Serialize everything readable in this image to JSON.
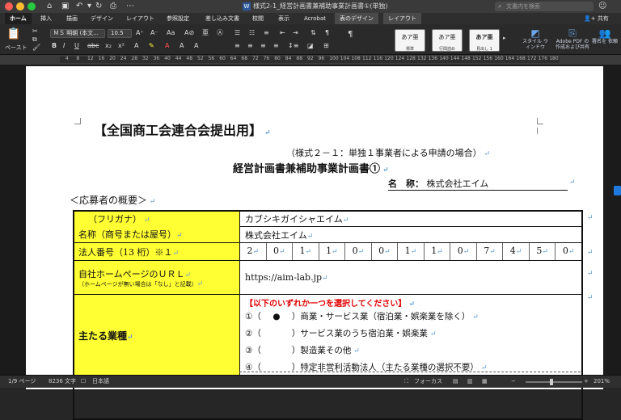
{
  "titlebar": {
    "document_title": "様式2-1_経営計画書兼補助事業計画書①(単独)",
    "search_placeholder": "文書内を検索"
  },
  "tabs": [
    {
      "label": "ホーム"
    },
    {
      "label": "挿入"
    },
    {
      "label": "描画"
    },
    {
      "label": "デザイン"
    },
    {
      "label": "レイアウト"
    },
    {
      "label": "参照設定"
    },
    {
      "label": "差し込み文書"
    },
    {
      "label": "校閲"
    },
    {
      "label": "表示"
    },
    {
      "label": "Acrobat"
    },
    {
      "label": "表のデザイン"
    },
    {
      "label": "レイアウト"
    }
  ],
  "share_label": "共有",
  "ribbon": {
    "paste_label": "ペースト",
    "font_name": "ＭＳ 明朝 (本文...",
    "font_size": "10.5",
    "styles": [
      {
        "sample": "あア亜",
        "name": "標準"
      },
      {
        "sample": "あア亜",
        "name": "行間詰め"
      },
      {
        "sample": "あア亜",
        "name": "見出し 1"
      }
    ],
    "styles_pane": "スタイル ウィンドウ",
    "adobe_pdf": "Adobe PDF の 作成および共有",
    "signature": "署名を 依頼"
  },
  "ruler": {
    "marks": [
      "2",
      "4",
      "6",
      "8",
      "10",
      "12",
      "14",
      "16",
      "18",
      "20",
      "22",
      "24",
      "26",
      "28",
      "30",
      "32",
      "34",
      "36",
      "38",
      "40",
      "42",
      "44",
      "46",
      "48",
      "50",
      "52",
      "54",
      "56",
      "58",
      "60",
      "62",
      "64",
      "66",
      "68",
      "70",
      "72",
      "74",
      "76",
      "78",
      "80",
      "82",
      "84",
      "86",
      "88",
      "90",
      "92",
      "94",
      "96",
      "98",
      "100",
      "102",
      "104",
      "106",
      "108",
      "110",
      "112",
      "114",
      "116",
      "118",
      "120",
      "122",
      "124",
      "126",
      "128",
      "130",
      "132",
      "134",
      "136",
      "138",
      "140",
      "142",
      "144",
      "146",
      "148",
      "150",
      "152",
      "154",
      "156",
      "158",
      "160",
      "162",
      "164",
      "166",
      "168",
      "170",
      "172",
      "174",
      "176",
      "178",
      "180"
    ]
  },
  "document": {
    "heading": "【全国商工会連合会提出用】",
    "subtitle": "（様式２－１：単独１事業者による申請の場合）",
    "plan_title": "経営計画書兼補助事業計画書①",
    "company_label": "名　称：",
    "company_value": "株式会社エイム",
    "overview": "＜応募者の概要＞",
    "rows": {
      "furigana_label": "（フリガナ）",
      "furigana_value": "カブシキガイシャエイム",
      "name_label": "名称（商号または屋号）",
      "name_value": "株式会社エイム",
      "corp_label": "法人番号（13 桁）※１",
      "corp_digits": [
        "2",
        "0",
        "1",
        "1",
        "0",
        "0",
        "1",
        "1",
        "0",
        "7",
        "4",
        "5",
        "0"
      ],
      "hp_label": "自社ホームページのＵＲＬ",
      "hp_note": "（ホームページが無い場合は「なし」と記載）",
      "hp_value": "https://aim-lab.jp",
      "business_label": "主たる業種",
      "business_instruction": "【以下のいずれか一つを選択してください】",
      "options": [
        {
          "num": "①",
          "mark": "●",
          "text": "商業・サービス業（宿泊業・娯楽業を除く）"
        },
        {
          "num": "②",
          "mark": "",
          "text": "サービス業のうち宿泊業・娯楽業"
        },
        {
          "num": "③",
          "mark": "",
          "text": "製造業その他"
        },
        {
          "num": "④",
          "mark": "",
          "text": "特定非営利活動法人（主たる業種の選択不要）"
        }
      ]
    }
  },
  "status": {
    "page": "1/9 ページ",
    "words": "8236 文字",
    "language": "日本語",
    "focus": "フォーカス",
    "zoom": "201%"
  }
}
